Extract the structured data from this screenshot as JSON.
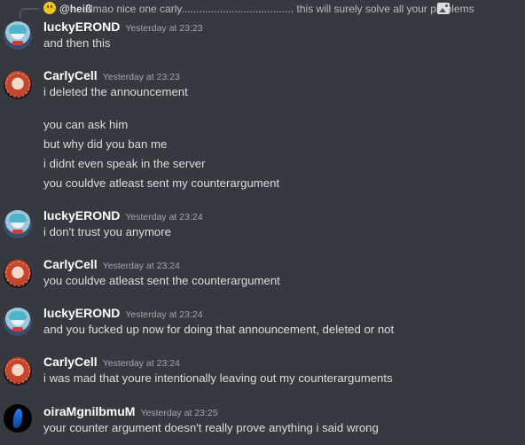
{
  "reply_preview": {
    "author": "@heiß",
    "text": "lmao nice one carly...................................... this will surely solve all your problems",
    "avatar_icon": "smiley-icon",
    "attachment_icon": "image-icon"
  },
  "messages": [
    {
      "author": "luckyEROND",
      "timestamp": "Yesterday at 23:23",
      "lines": [
        "and then this"
      ]
    },
    {
      "author": "CarlyCell",
      "timestamp": "Yesterday at 23:23",
      "lines": [
        "i deleted the announcement",
        "you can ask him",
        "but why did you ban me",
        "i didnt even speak in the server",
        "you couldve atleast sent my counterargument"
      ]
    },
    {
      "author": "luckyEROND",
      "timestamp": "Yesterday at 23:24",
      "lines": [
        "i don't trust you anymore"
      ]
    },
    {
      "author": "CarlyCell",
      "timestamp": "Yesterday at 23:24",
      "lines": [
        "you couldve atleast sent the counterargument"
      ]
    },
    {
      "author": "luckyEROND",
      "timestamp": "Yesterday at 23:24",
      "lines": [
        "and you fucked up now for doing that announcement, deleted or not"
      ]
    },
    {
      "author": "CarlyCell",
      "timestamp": "Yesterday at 23:24",
      "lines": [
        "i was mad that youre intentionally leaving out my counterarguments"
      ]
    },
    {
      "author": "oiraMgnilbmuM",
      "timestamp": "Yesterday at 23:25",
      "lines": [
        "your counter argument doesn't really prove anything i said wrong"
      ]
    }
  ]
}
